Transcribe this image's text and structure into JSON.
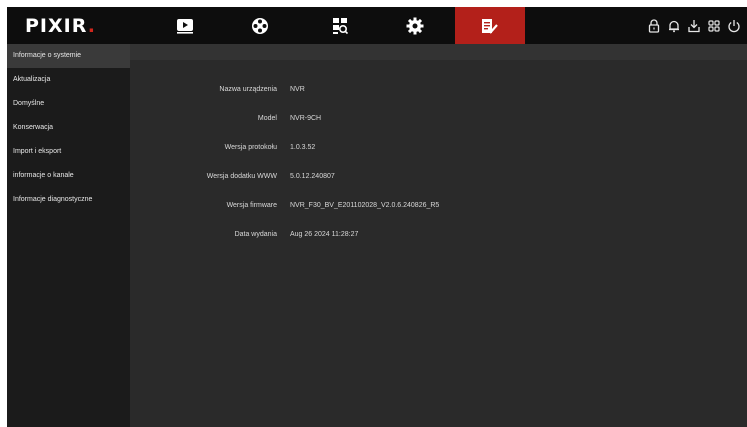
{
  "logo": {
    "text": "PIXIR",
    "dot": "."
  },
  "nav": {
    "tabs": [
      {
        "name": "playback-tab",
        "icon": "play-icon"
      },
      {
        "name": "channels-tab",
        "icon": "camera-reel-icon"
      },
      {
        "name": "search-tab",
        "icon": "file-search-icon"
      },
      {
        "name": "settings-tab",
        "icon": "gear-icon"
      },
      {
        "name": "system-tab",
        "icon": "edit-document-icon",
        "active": true
      }
    ],
    "active_color": "#b3201a"
  },
  "right_icons": [
    "lock-icon",
    "bell-icon",
    "download-icon",
    "grid-icon",
    "power-icon"
  ],
  "sidebar": {
    "items": [
      {
        "label": "Informacje o systemie",
        "active": true
      },
      {
        "label": "Aktualizacja"
      },
      {
        "label": "Domyślne"
      },
      {
        "label": "Konserwacja"
      },
      {
        "label": "Import i eksport"
      },
      {
        "label": "informacje o kanale"
      },
      {
        "label": "Informacje diagnostyczne"
      }
    ]
  },
  "info": {
    "rows": [
      {
        "label": "Nazwa urządzenia",
        "value": "NVR"
      },
      {
        "label": "Model",
        "value": "NVR-9CH"
      },
      {
        "label": "Wersja protokołu",
        "value": "1.0.3.52"
      },
      {
        "label": "Wersja dodatku WWW",
        "value": "5.0.12.240807"
      },
      {
        "label": "Wersja firmware",
        "value": "NVR_F30_BV_E201102028_V2.0.6.240826_R5"
      },
      {
        "label": "Data wydania",
        "value": "Aug 26 2024  11:28:27"
      }
    ]
  }
}
